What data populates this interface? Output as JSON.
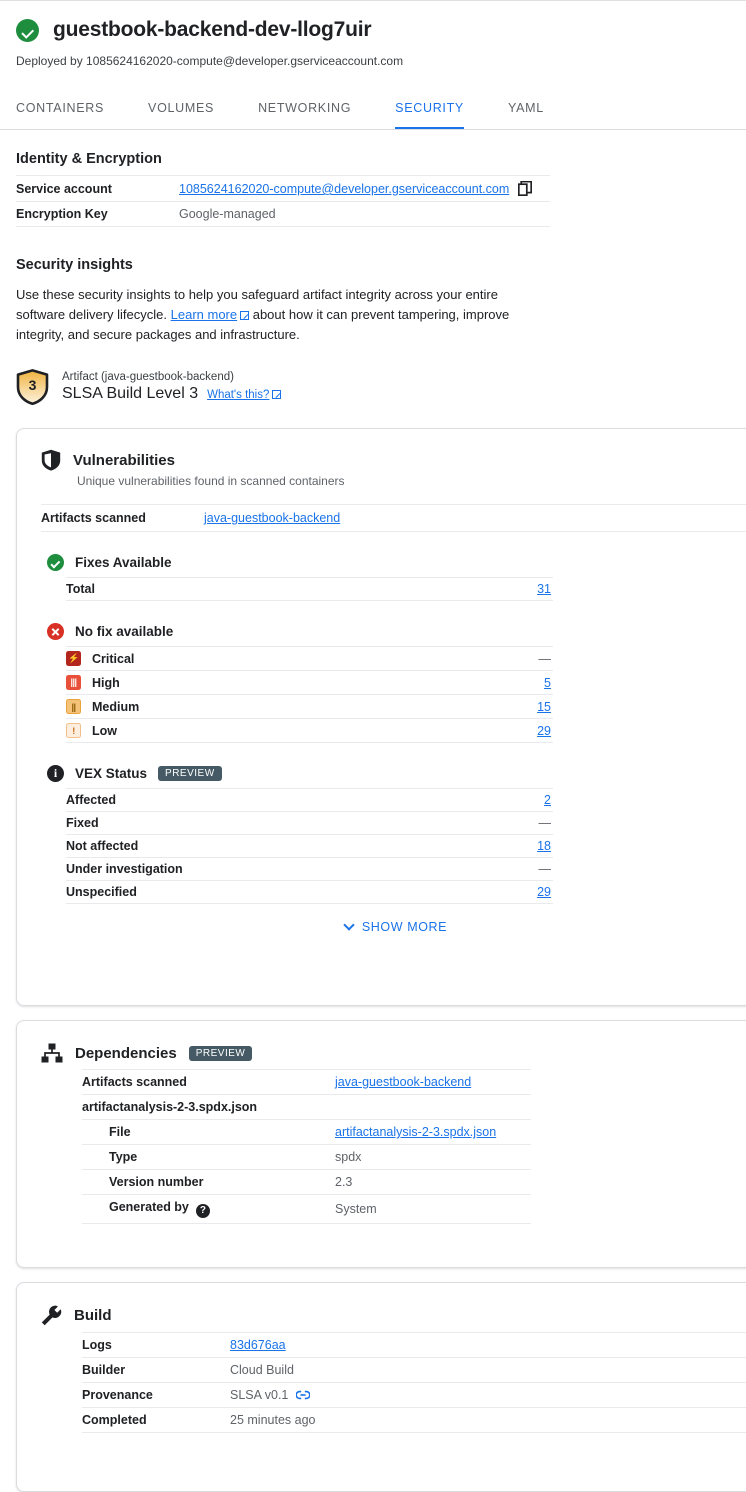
{
  "header": {
    "status_icon": "check-circle-icon",
    "title": "guestbook-backend-dev-llog7uir",
    "deployed_by": "Deployed by 1085624162020-compute@developer.gserviceaccount.com"
  },
  "tabs": [
    {
      "label": "CONTAINERS",
      "active": false
    },
    {
      "label": "VOLUMES",
      "active": false
    },
    {
      "label": "NETWORKING",
      "active": false
    },
    {
      "label": "SECURITY",
      "active": true
    },
    {
      "label": "YAML",
      "active": false
    }
  ],
  "identity": {
    "heading": "Identity & Encryption",
    "rows": [
      {
        "key": "Service account",
        "value": "1085624162020-compute@developer.gserviceaccount.com",
        "link": true,
        "copy_icon": "copy-icon"
      },
      {
        "key": "Encryption Key",
        "value": "Google-managed",
        "link": false
      }
    ]
  },
  "security_insights": {
    "heading": "Security insights",
    "paragraph_part1": "Use these security insights to help you safeguard artifact integrity across your entire software delivery lifecycle. ",
    "learn_more": "Learn more",
    "paragraph_part2": " about how it can prevent tampering, improve integrity, and secure packages and infrastructure.",
    "slsa": {
      "badge_level": "3",
      "artifact_label": "Artifact (java-guestbook-backend)",
      "title": "SLSA Build Level 3",
      "whats_this": "What's this?"
    }
  },
  "vulnerabilities": {
    "icon": "shield-icon",
    "title": "Vulnerabilities",
    "subtitle": "Unique vulnerabilities found in scanned containers",
    "artifacts_scanned": {
      "key": "Artifacts scanned",
      "value": "java-guestbook-backend"
    },
    "fixes_available": {
      "icon": "check-circle-icon",
      "title": "Fixes Available",
      "rows": [
        {
          "label": "Total",
          "value": "31",
          "link": true
        }
      ]
    },
    "no_fix_available": {
      "icon": "error-circle-icon",
      "title": "No fix available",
      "rows": [
        {
          "severity": "critical",
          "icon": "severity-critical-icon",
          "glyph": "⚡",
          "label": "Critical",
          "value": "—",
          "link": false
        },
        {
          "severity": "high",
          "icon": "severity-high-icon",
          "glyph": "‖",
          "label": "High",
          "value": "5",
          "link": true
        },
        {
          "severity": "medium",
          "icon": "severity-medium-icon",
          "glyph": "‖",
          "label": "Medium",
          "value": "15",
          "link": true
        },
        {
          "severity": "low",
          "icon": "severity-low-icon",
          "glyph": "!",
          "label": "Low",
          "value": "29",
          "link": true
        }
      ]
    },
    "vex_status": {
      "icon": "info-icon",
      "title": "VEX Status",
      "badge": "PREVIEW",
      "rows": [
        {
          "label": "Affected",
          "value": "2",
          "link": true
        },
        {
          "label": "Fixed",
          "value": "—",
          "link": false
        },
        {
          "label": "Not affected",
          "value": "18",
          "link": true
        },
        {
          "label": "Under investigation",
          "value": "—",
          "link": false
        },
        {
          "label": "Unspecified",
          "value": "29",
          "link": true
        }
      ]
    },
    "show_more": "SHOW MORE"
  },
  "dependencies": {
    "icon": "dependencies-icon",
    "title": "Dependencies",
    "badge": "PREVIEW",
    "artifacts_scanned": {
      "key": "Artifacts scanned",
      "value": "java-guestbook-backend"
    },
    "file_group": "artifactanalysis-2-3.spdx.json",
    "rows": [
      {
        "key": "File",
        "value": "artifactanalysis-2-3.spdx.json",
        "link": true
      },
      {
        "key": "Type",
        "value": "spdx",
        "link": false
      },
      {
        "key": "Version number",
        "value": "2.3",
        "link": false
      },
      {
        "key": "Generated by",
        "value": "System",
        "link": false,
        "help_icon": "help-icon"
      }
    ]
  },
  "build": {
    "icon": "wrench-icon",
    "title": "Build",
    "rows": [
      {
        "key": "Logs",
        "value": "83d676aa",
        "link": true
      },
      {
        "key": "Builder",
        "value": "Cloud Build",
        "link": false
      },
      {
        "key": "Provenance",
        "value": "SLSA v0.1",
        "link": false,
        "trailing_icon": "link-icon"
      },
      {
        "key": "Completed",
        "value": "25 minutes ago",
        "link": false
      }
    ]
  },
  "colors": {
    "accent_blue": "#1a73e8",
    "success_green": "#1e8e3e",
    "error_red": "#d93025",
    "badge_slate": "#455a64",
    "text_primary": "#202124",
    "text_secondary": "#5f6368"
  }
}
